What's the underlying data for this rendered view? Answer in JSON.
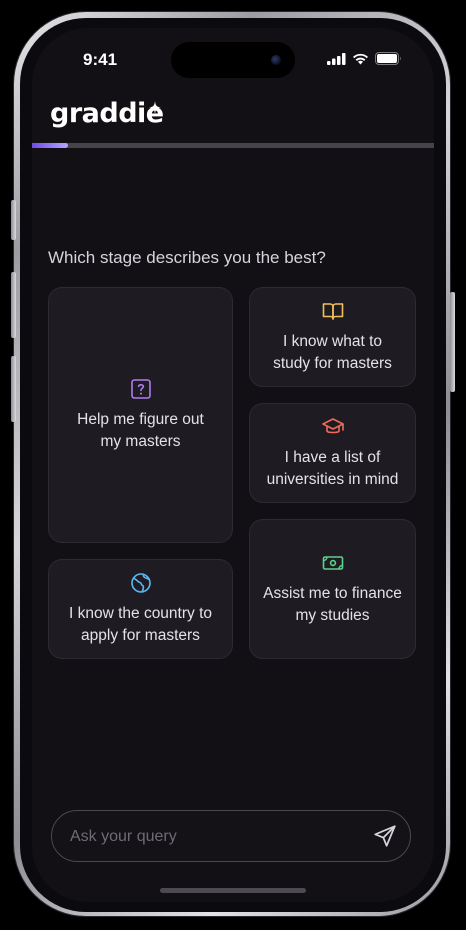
{
  "status_bar": {
    "time": "9:41",
    "icons": [
      "cellular-signal-icon",
      "wifi-icon",
      "battery-icon"
    ]
  },
  "header": {
    "logo_text": "graddie",
    "logo_accent_icon": "sparkle-icon"
  },
  "progress": {
    "fraction": 0.09,
    "fill_color": "#8f7bff"
  },
  "main": {
    "question": "Which stage describes you the best?",
    "options": [
      {
        "label": "Help me figure out my masters",
        "icon": "question-mark-icon",
        "icon_color": "#b07cf0"
      },
      {
        "label": "I know what to study for masters",
        "icon": "open-book-icon",
        "icon_color": "#f0c05a"
      },
      {
        "label": "I have a list of universities in mind",
        "icon": "graduation-cap-icon",
        "icon_color": "#f06a5a"
      },
      {
        "label": "I know the country to apply for masters",
        "icon": "globe-icon",
        "icon_color": "#5ab8f0"
      },
      {
        "label": "Assist me to finance my studies",
        "icon": "banknote-icon",
        "icon_color": "#5fd08a"
      }
    ]
  },
  "query": {
    "placeholder": "Ask your query",
    "value": "",
    "send_icon": "send-icon"
  }
}
